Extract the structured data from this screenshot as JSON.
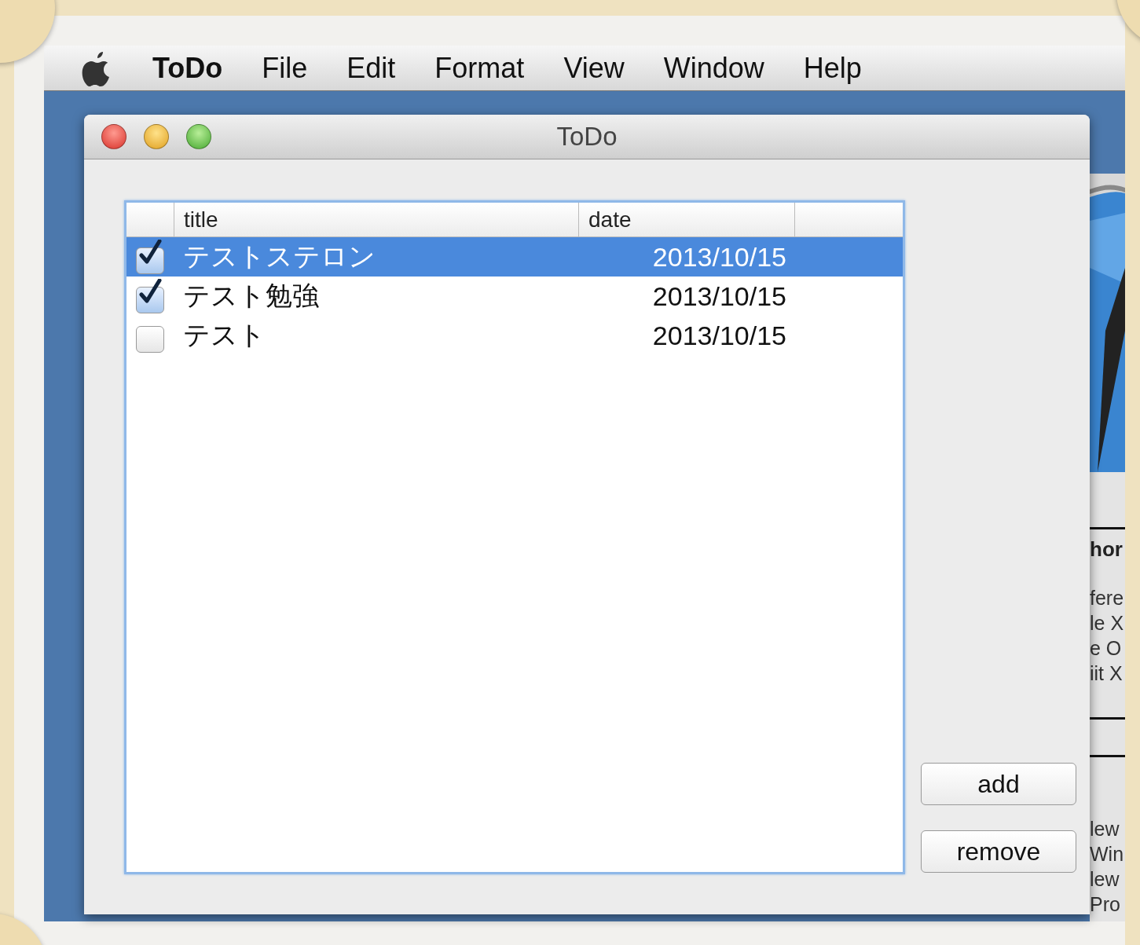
{
  "menu_bar": {
    "app_name": "ToDo",
    "items": [
      "File",
      "Edit",
      "Format",
      "View",
      "Window",
      "Help"
    ]
  },
  "window": {
    "title": "ToDo"
  },
  "table": {
    "columns": [
      "title",
      "date"
    ],
    "rows": [
      {
        "checked": true,
        "selected": true,
        "title": "テストステロン",
        "date": "2013/10/15"
      },
      {
        "checked": true,
        "selected": false,
        "title": "テスト勉強",
        "date": "2013/10/15"
      },
      {
        "checked": false,
        "selected": false,
        "title": "テスト",
        "date": "2013/10/15"
      }
    ]
  },
  "buttons": [
    "add",
    "remove"
  ],
  "background_window": {
    "heading": "hor",
    "lines_1": [
      "fere",
      "le X",
      "e O",
      "iit X"
    ],
    "lines_2": [
      "lew",
      "Win",
      "lew",
      "Pro"
    ]
  }
}
